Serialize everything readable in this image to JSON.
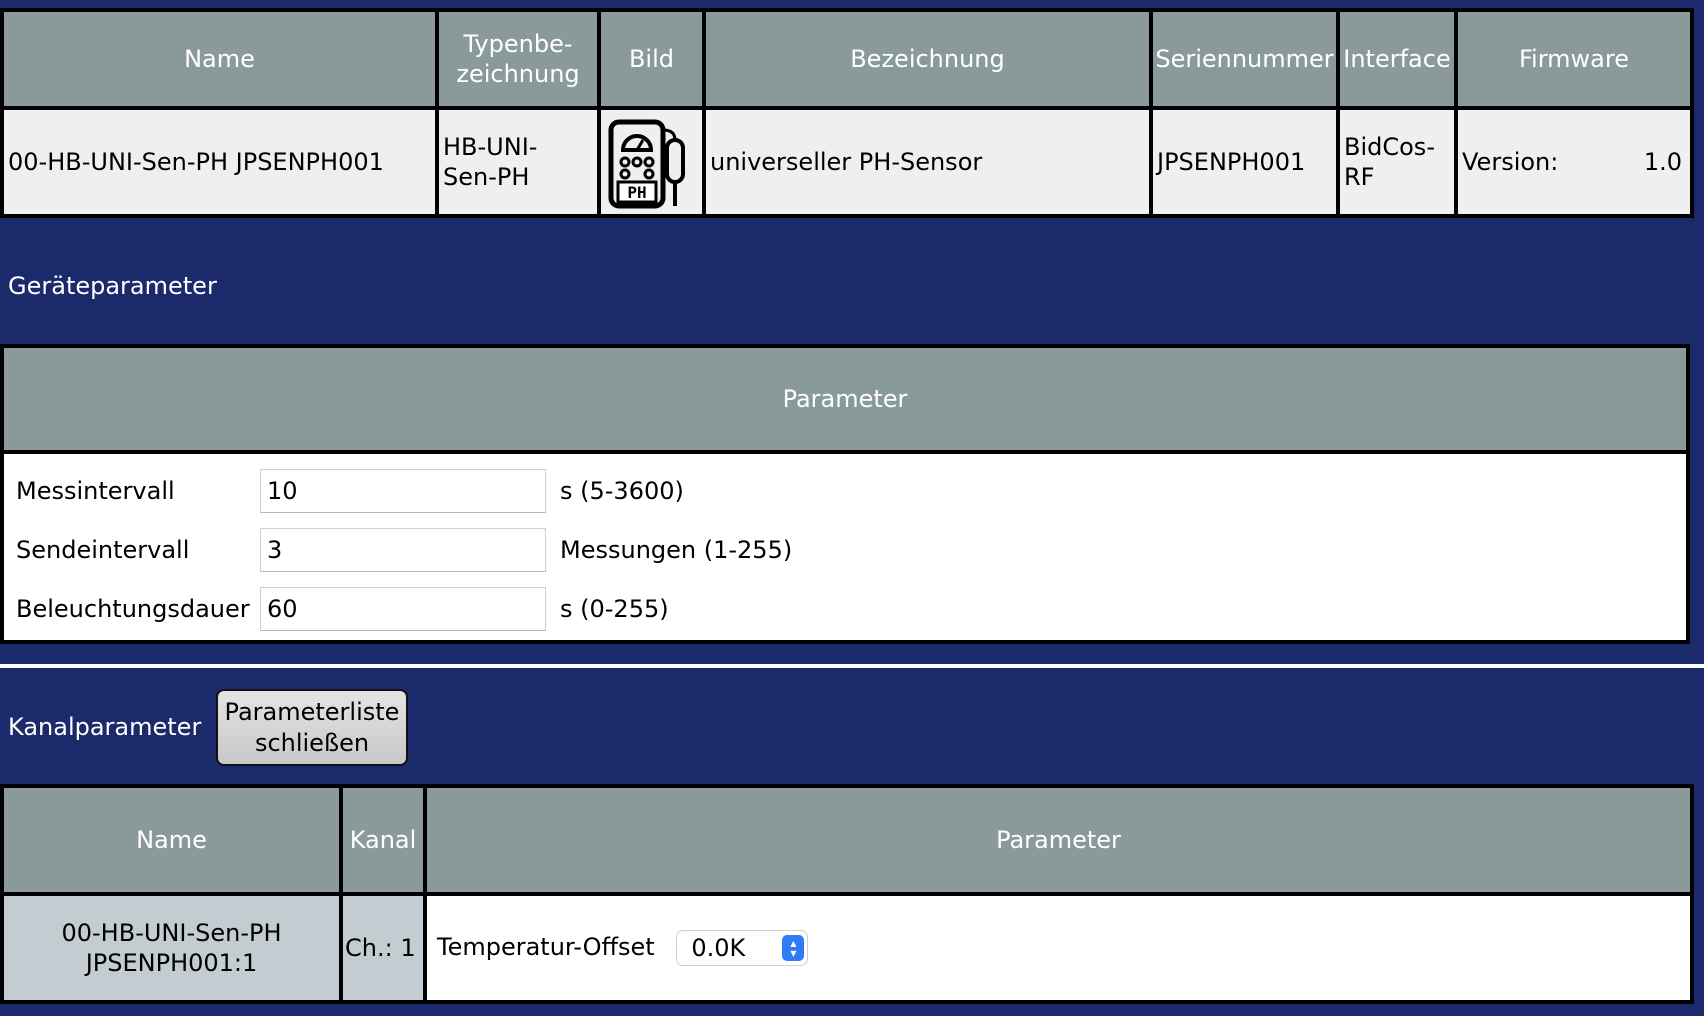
{
  "device_table": {
    "headers": {
      "name": "Name",
      "type": "Typenbe-\nzeichnung",
      "image": "Bild",
      "description": "Bezeichnung",
      "serial": "Seriennummer",
      "interface": "Interface",
      "firmware": "Firmware"
    },
    "row": {
      "name": "00-HB-UNI-Sen-PH JPSENPH001",
      "type": "HB-UNI-\nSen-PH",
      "image_icon": "ph-sensor-device-icon",
      "image_text": "PH",
      "description": "universeller PH-Sensor",
      "serial": "JPSENPH001",
      "interface": "BidCos-\nRF",
      "firmware_label": "Version:",
      "firmware_value": "1.0"
    }
  },
  "device_params": {
    "section_title": "Geräteparameter",
    "header": "Parameter",
    "rows": [
      {
        "label": "Messintervall",
        "value": "10",
        "unit": "s (5-3600)"
      },
      {
        "label": "Sendeintervall",
        "value": "3",
        "unit": "Messungen (1-255)"
      },
      {
        "label": "Beleuchtungsdauer",
        "value": "60",
        "unit": "s (0-255)"
      }
    ]
  },
  "channel_params": {
    "section_title": "Kanalparameter",
    "close_button": "Parameterliste\nschließen",
    "headers": {
      "name": "Name",
      "channel": "Kanal",
      "parameter": "Parameter"
    },
    "row": {
      "name": "00-HB-UNI-Sen-PH\nJPSENPH001:1",
      "channel": "Ch.: 1",
      "param_label": "Temperatur-Offset",
      "param_value": "0.0K"
    }
  },
  "colors": {
    "page_background": "#1b2a6b",
    "header_background": "#8a9a9b",
    "cell_background": "#efefef",
    "channel_name_background": "#c3ccd0",
    "select_accent": "#2f7cf6"
  }
}
